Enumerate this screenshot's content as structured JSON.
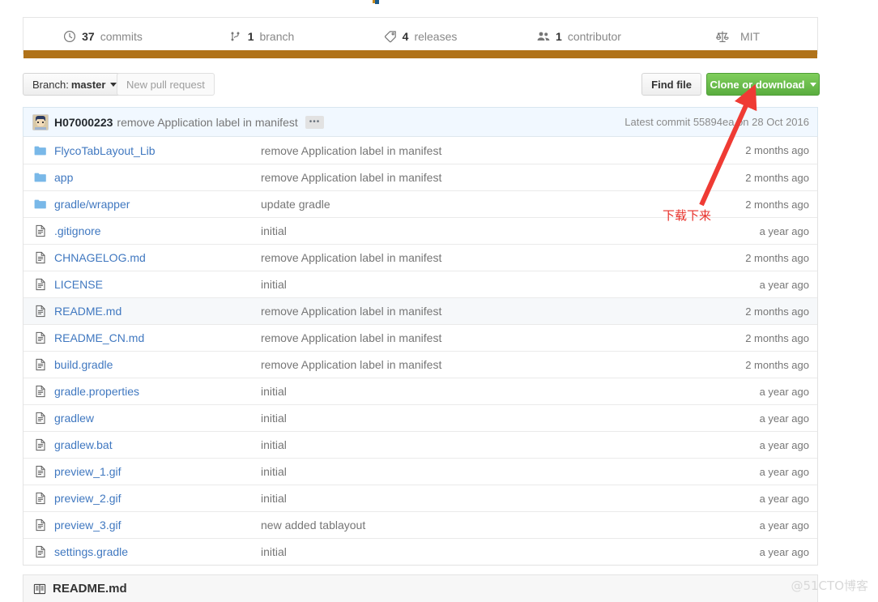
{
  "colors": {
    "link": "#4078c0",
    "language_bar": "#b07219",
    "clone_button": "#5aad3f",
    "annotation_red": "#e8302a",
    "commit_tease_bg": "#f1f8ff",
    "row_hover": "#f6f8fa"
  },
  "numbers_summary": [
    {
      "icon": "history-icon",
      "count": "37",
      "label": "commits"
    },
    {
      "icon": "branch-icon",
      "count": "1",
      "label": "branch"
    },
    {
      "icon": "tag-icon",
      "count": "4",
      "label": "releases"
    },
    {
      "icon": "people-icon",
      "count": "1",
      "label": "contributor"
    },
    {
      "icon": "law-icon",
      "count": "",
      "label": "MIT"
    }
  ],
  "toolbar": {
    "branch_prefix": "Branch:",
    "branch_name": "master",
    "new_pull_request": "New pull request",
    "find_file": "Find file",
    "clone_or_download": "Clone or download"
  },
  "commit_tease": {
    "author": "H07000223",
    "message": "remove Application label in manifest",
    "ellipsis": "•••",
    "latest_commit_label": "Latest commit",
    "sha": "55894ea",
    "on_label": "on",
    "date": "28 Oct 2016"
  },
  "files": {
    "columns": [
      "name",
      "message",
      "age"
    ],
    "rows": [
      {
        "type": "folder",
        "name": "FlycoTabLayout_Lib",
        "message": "remove Application label in manifest",
        "age": "2 months ago",
        "hover": false
      },
      {
        "type": "folder",
        "name": "app",
        "message": "remove Application label in manifest",
        "age": "2 months ago",
        "hover": false
      },
      {
        "type": "folder",
        "name": "gradle/wrapper",
        "message": "update gradle",
        "age": "2 months ago",
        "hover": false
      },
      {
        "type": "file",
        "name": ".gitignore",
        "message": "initial",
        "age": "a year ago",
        "hover": false
      },
      {
        "type": "file",
        "name": "CHNAGELOG.md",
        "message": "remove Application label in manifest",
        "age": "2 months ago",
        "hover": false
      },
      {
        "type": "file",
        "name": "LICENSE",
        "message": "initial",
        "age": "a year ago",
        "hover": false
      },
      {
        "type": "file",
        "name": "README.md",
        "message": "remove Application label in manifest",
        "age": "2 months ago",
        "hover": true
      },
      {
        "type": "file",
        "name": "README_CN.md",
        "message": "remove Application label in manifest",
        "age": "2 months ago",
        "hover": false
      },
      {
        "type": "file",
        "name": "build.gradle",
        "message": "remove Application label in manifest",
        "age": "2 months ago",
        "hover": false
      },
      {
        "type": "file",
        "name": "gradle.properties",
        "message": "initial",
        "age": "a year ago",
        "hover": false
      },
      {
        "type": "file",
        "name": "gradlew",
        "message": "initial",
        "age": "a year ago",
        "hover": false
      },
      {
        "type": "file",
        "name": "gradlew.bat",
        "message": "initial",
        "age": "a year ago",
        "hover": false
      },
      {
        "type": "file",
        "name": "preview_1.gif",
        "message": "initial",
        "age": "a year ago",
        "hover": false
      },
      {
        "type": "file",
        "name": "preview_2.gif",
        "message": "initial",
        "age": "a year ago",
        "hover": false
      },
      {
        "type": "file",
        "name": "preview_3.gif",
        "message": "new added tablayout",
        "age": "a year ago",
        "hover": false
      },
      {
        "type": "file",
        "name": "settings.gradle",
        "message": "initial",
        "age": "a year ago",
        "hover": false
      }
    ]
  },
  "readme": {
    "icon": "book-icon",
    "title": "README.md"
  },
  "annotations": {
    "arrow_note": "下载下来",
    "watermark": "@51CTO博客"
  }
}
